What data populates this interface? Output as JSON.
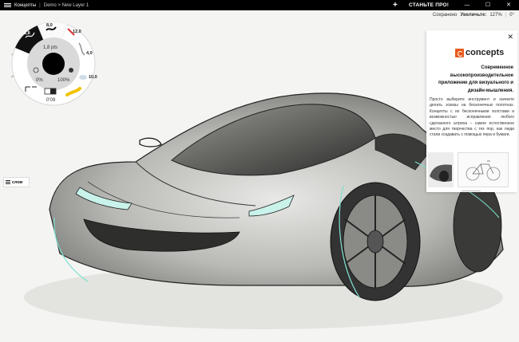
{
  "titlebar": {
    "app_name": "Концепты",
    "separator": "|",
    "breadcrumb": "Demo > New Layer 1",
    "plus": "+",
    "pro_button": "СТАНЬТЕ ПРО!",
    "minimize": "—",
    "maximize": "☐",
    "close": "✕"
  },
  "status": {
    "saved": "Сохранено",
    "zoom_label": "Увеличьте:",
    "zoom_value": "127%",
    "rotation": "0°"
  },
  "tool_wheel": {
    "tool_1": "1,8",
    "tool_2": "8,0",
    "tool_3": "12,0",
    "tool_4": "4,0",
    "tool_5": "10,0",
    "size_value": "1,8 pts",
    "opacity_value": "0%",
    "smoothing_value": "100%",
    "color_value": "0'09"
  },
  "layers_button": {
    "label": "слои"
  },
  "promo": {
    "close": "✕",
    "logo_text": "concepts",
    "headline": "Современное высокопроизводительное приложение для визуального и дизайн-мышления.",
    "body": "Просто выберите инструмент и начните делать эскизы на бесконечных полотнах. Концепты с их бесконечными холстами и возможностью исправления любого сделанного штриха – самое естественное место для творчества с тех пор, как люди стали создавать с помощью пера и бумаги."
  },
  "colors": {
    "accent": "#e85a1c",
    "highlight": "#7de3d0"
  }
}
